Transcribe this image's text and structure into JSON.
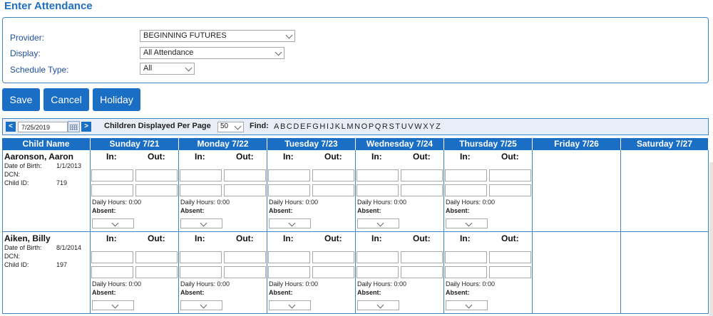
{
  "page_title": "Enter Attendance",
  "filters": [
    {
      "label": "Provider:",
      "value": "BEGINNING FUTURES"
    },
    {
      "label": "Display:",
      "value": "All Attendance"
    },
    {
      "label": "Schedule Type:",
      "value": "All"
    }
  ],
  "buttons": {
    "save": "Save",
    "cancel": "Cancel",
    "holiday": "Holiday"
  },
  "toolbar": {
    "prev": "<",
    "next": ">",
    "date": "7/25/2019",
    "per_page_label": "Children Displayed Per Page",
    "per_page_value": "50",
    "find_label": "Find:",
    "letters": [
      "A",
      "B",
      "C",
      "D",
      "E",
      "F",
      "G",
      "H",
      "I",
      "J",
      "K",
      "L",
      "M",
      "N",
      "O",
      "P",
      "Q",
      "R",
      "S",
      "T",
      "U",
      "V",
      "W",
      "X",
      "Y",
      "Z"
    ]
  },
  "columns": [
    "Child Name",
    "Sunday 7/21",
    "Monday 7/22",
    "Tuesday 7/23",
    "Wednesday 7/24",
    "Thursday 7/25",
    "Friday 7/26",
    "Saturday 7/27"
  ],
  "labels": {
    "in": "In:",
    "out": "Out:",
    "dob": "Date of Birth:",
    "dcn": "DCN:",
    "child_id": "Child ID:",
    "daily_hours": "Daily Hours: 0:00",
    "absent": "Absent:"
  },
  "children": [
    {
      "name": "Aaronson, Aaron",
      "dob": "1/1/2013",
      "dcn": "",
      "child_id": "719"
    },
    {
      "name": "Aiken, Billy",
      "dob": "8/1/2014",
      "dcn": "",
      "child_id": "197"
    }
  ]
}
